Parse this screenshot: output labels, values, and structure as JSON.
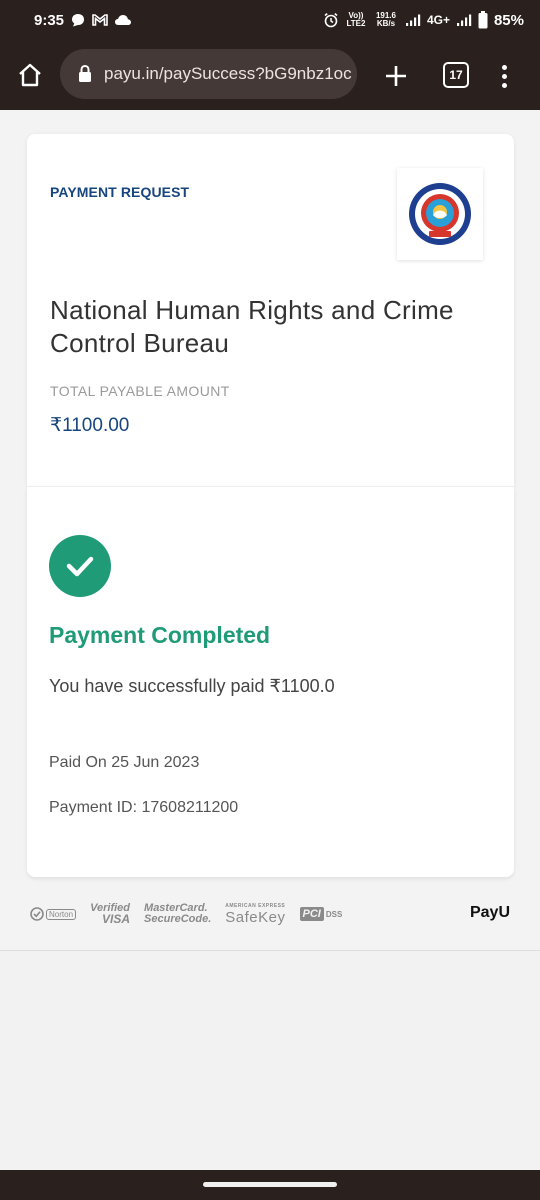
{
  "status_bar": {
    "time": "9:35",
    "network_top": "Vo)) LTE2",
    "speed_value": "191.6",
    "speed_unit": "KB/s",
    "network_type": "4G+",
    "battery": "85%"
  },
  "browser": {
    "url": "payu.in/paySuccess?bG9nbz1oc",
    "tab_count": "17"
  },
  "merchant": {
    "section_label": "PAYMENT REQUEST",
    "name": "National Human Rights and Crime Control Bureau",
    "logo_text": "NATIONAL HUMAN RIGHTS AND CRIME CONTROL BUREAU",
    "logo_badge": "NHRCCB",
    "payable_label": "TOTAL PAYABLE AMOUNT",
    "payable_amount": "₹1100.00"
  },
  "result": {
    "title": "Payment Completed",
    "message": "You have successfully paid ₹1100.0",
    "paid_on": "Paid On 25 Jun 2023",
    "payment_id": "Payment ID: 17608211200"
  },
  "trust_badges": {
    "norton": "Norton",
    "verified_visa_1": "Verified",
    "verified_visa_2": "VISA",
    "mastercard_1": "MasterCard.",
    "mastercard_2": "SecureCode.",
    "amex_small": "AMERICAN EXPRESS",
    "safekey": "SafeKey",
    "pci": "PCI",
    "dss": "DSS",
    "payu": "PayU"
  },
  "colors": {
    "brand_blue": "#17457f",
    "success_green": "#1f9b78",
    "chrome_dark": "#2a201d"
  }
}
